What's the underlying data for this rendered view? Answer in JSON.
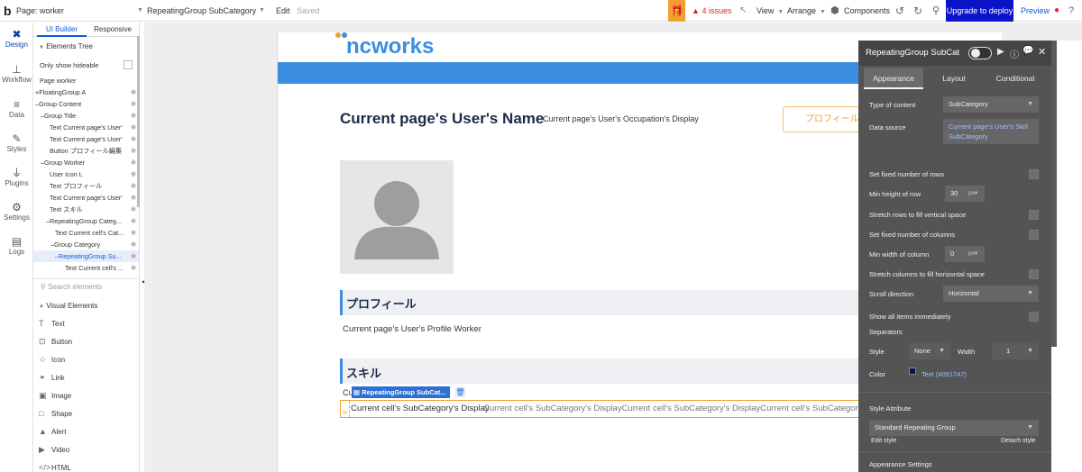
{
  "topbar": {
    "logo": "b",
    "page_selector": "Page: worker",
    "element_selector": "RepeatingGroup SubCategory",
    "edit": "Edit",
    "saved": "Saved",
    "issues": "4 issues",
    "view": "View",
    "arrange": "Arrange",
    "components": "Components",
    "upgrade": "Upgrade to deploy",
    "preview": "Preview"
  },
  "sidebar": {
    "items": [
      {
        "label": "Design",
        "icon": "design-icon"
      },
      {
        "label": "Workflow",
        "icon": "workflow-icon"
      },
      {
        "label": "Data",
        "icon": "database-icon"
      },
      {
        "label": "Styles",
        "icon": "brush-icon"
      },
      {
        "label": "Plugins",
        "icon": "plug-icon"
      },
      {
        "label": "Settings",
        "icon": "gear-icon"
      },
      {
        "label": "Logs",
        "icon": "logs-icon"
      }
    ]
  },
  "panel": {
    "tab_ui": "UI Builder",
    "tab_responsive": "Responsive",
    "elements_tree": "Elements Tree",
    "only_hideable": "Only show hideable",
    "tree": [
      "Page worker",
      "FloatingGroup A",
      "Group Content",
      "Group Title",
      "Text Current page's User'",
      "Text Current page's User'",
      "Button プロフィール編集",
      "Group Worker",
      "User Icon L",
      "Text プロフィール",
      "Text Current page's User'",
      "Text スキル",
      "RepeatingGroup Categ...",
      "Text Current cell's Cat...",
      "Group Category",
      "RepeatingGroup Su...",
      "Text Current cell's ..."
    ],
    "search_placeholder": "Search elements",
    "visual_elements": "Visual Elements",
    "elements": [
      {
        "label": "Text",
        "icon": "text-icon"
      },
      {
        "label": "Button",
        "icon": "button-icon"
      },
      {
        "label": "Icon",
        "icon": "star-icon"
      },
      {
        "label": "Link",
        "icon": "link-icon"
      },
      {
        "label": "Image",
        "icon": "image-icon"
      },
      {
        "label": "Shape",
        "icon": "shape-icon"
      },
      {
        "label": "Alert",
        "icon": "alert-icon"
      },
      {
        "label": "Video",
        "icon": "video-icon"
      },
      {
        "label": "HTML",
        "icon": "html-icon"
      }
    ]
  },
  "page": {
    "logo_text": "ncworks",
    "user_name": "Current page's User's Name",
    "occupation": "Current page's User's Occupation's Display",
    "edit_profile_button": "プロフィール編",
    "profile_heading": "プロフィール",
    "profile_text": "Current page's User's Profile Worker",
    "skills_heading": "スキル",
    "rg_cu_prefix": "Cu",
    "rg_tag": "RepeatingGroup SubCat...",
    "cell_first": "Current cell's SubCategory's Display",
    "cell_repeat": "Current cell's SubCategory's DisplayCurrent cell's SubCategory's DisplayCurrent cell's SubCategory's Di"
  },
  "editor": {
    "title": "RepeatingGroup SubCat",
    "tabs": [
      "Appearance",
      "Layout",
      "Conditional"
    ],
    "type_of_content_label": "Type of content",
    "type_of_content_value": "SubCategory",
    "data_source_label": "Data source",
    "data_source_value": "Current page's User's Skill SubCategory",
    "fixed_rows": "Set fixed number of rows",
    "min_height_label": "Min height of row",
    "min_height_value": "30",
    "unit_px": "px",
    "stretch_rows": "Stretch rows to fill vertical space",
    "fixed_cols": "Set fixed number of columns",
    "min_width_label": "Min width of column",
    "min_width_value": "0",
    "stretch_cols": "Stretch columns to fill horizontal space",
    "scroll_dir_label": "Scroll direction",
    "scroll_dir_value": "Horizontal",
    "show_all": "Show all items immediately",
    "separators": "Separators",
    "style_label": "Style",
    "style_value": "None",
    "width_label": "Width",
    "width_value": "1",
    "color_label": "Color",
    "color_value": "Text (#091747)",
    "style_attribute": "Style Attribute",
    "style_attr_value": "Standard Repeating Group",
    "edit_style": "Edit style",
    "detach_style": "Detach style",
    "appearance_settings": "Appearance Settings"
  },
  "colors": {
    "accent_blue": "#0b5cd6",
    "upgrade_bg": "#0b14c6",
    "page_bar": "#3b8de0",
    "editor_bg": "#545454",
    "orange": "#f0a030",
    "issues_red": "#d9262c"
  }
}
